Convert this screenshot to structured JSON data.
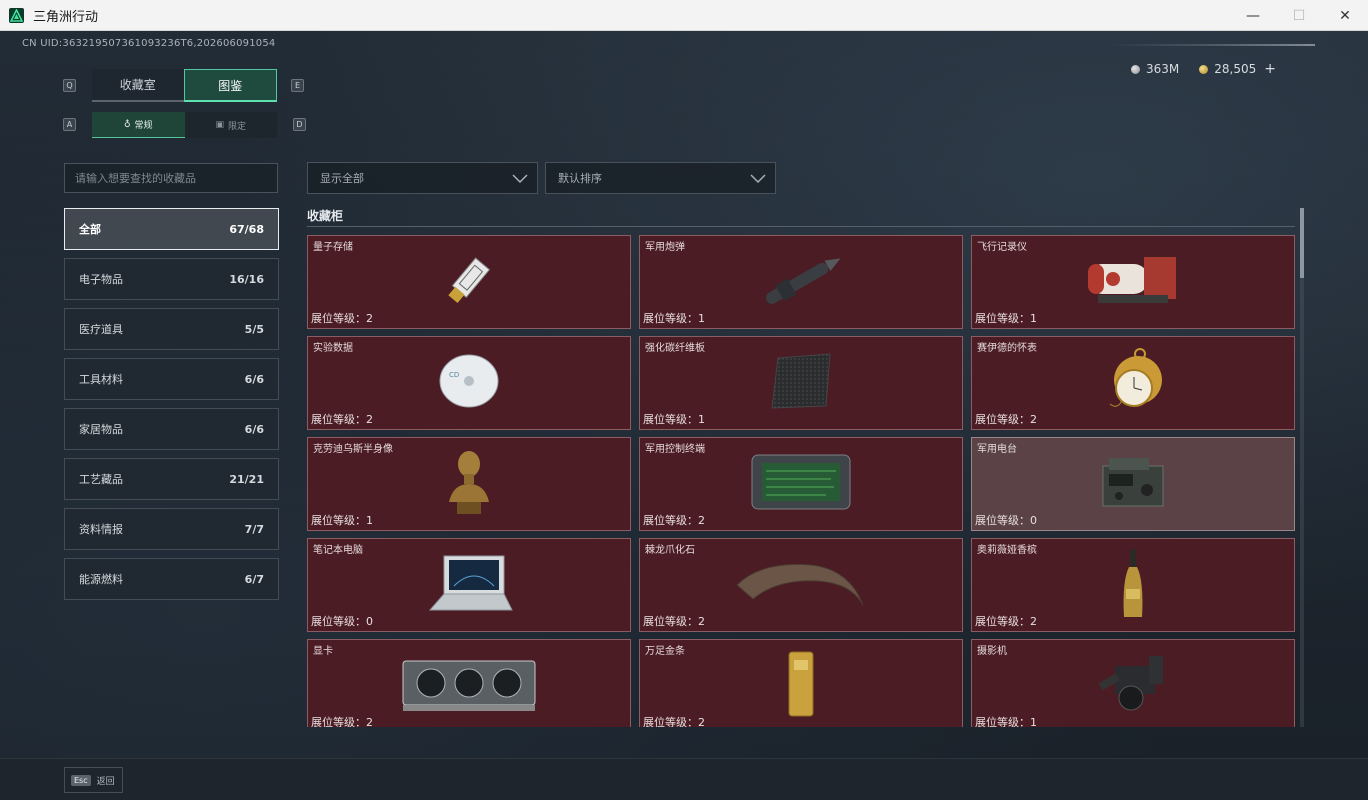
{
  "window": {
    "title": "三角洲行动",
    "controls": {
      "minimize": "—",
      "maximize": "☐",
      "close": "✕"
    }
  },
  "header": {
    "uid_text": "CN UID:363219507361093236T6,202606091054",
    "currency": {
      "silver": "363M",
      "gold": "28,505",
      "add": "+"
    },
    "key_hints": {
      "tab_prev": "Q",
      "tab_next": "E",
      "sub_prev": "A",
      "sub_next": "D"
    }
  },
  "tabs": [
    {
      "label": "收藏室",
      "active": false
    },
    {
      "label": "图鉴",
      "active": true
    }
  ],
  "subtabs": [
    {
      "label": "常规",
      "icon": "flask-icon",
      "glyph": "♁",
      "active": true
    },
    {
      "label": "限定",
      "icon": "box-icon",
      "glyph": "▣",
      "active": false
    }
  ],
  "search": {
    "placeholder": "请输入想要查找的收藏品"
  },
  "categories": [
    {
      "label": "全部",
      "count": "67/68",
      "active": true
    },
    {
      "label": "电子物品",
      "count": "16/16",
      "active": false
    },
    {
      "label": "医疗道具",
      "count": "5/5",
      "active": false
    },
    {
      "label": "工具材料",
      "count": "6/6",
      "active": false
    },
    {
      "label": "家居物品",
      "count": "6/6",
      "active": false
    },
    {
      "label": "工艺藏品",
      "count": "21/21",
      "active": false
    },
    {
      "label": "资料情报",
      "count": "7/7",
      "active": false
    },
    {
      "label": "能源燃料",
      "count": "6/7",
      "active": false
    }
  ],
  "filters": {
    "show": "显示全部",
    "sort": "默认排序"
  },
  "section": {
    "title": "收藏柜"
  },
  "items": [
    {
      "name": "量子存储",
      "level": "展位等级：2",
      "art": "usb-icon"
    },
    {
      "name": "军用炮弹",
      "level": "展位等级：1",
      "art": "shell-icon"
    },
    {
      "name": "飞行记录仪",
      "level": "展位等级：1",
      "art": "recorder-icon"
    },
    {
      "name": "实验数据",
      "level": "展位等级：2",
      "art": "disc-icon"
    },
    {
      "name": "强化碳纤维板",
      "level": "展位等级：1",
      "art": "carbon-plate-icon"
    },
    {
      "name": "赛伊德的怀表",
      "level": "展位等级：2",
      "art": "pocket-watch-icon"
    },
    {
      "name": "克劳迪乌斯半身像",
      "level": "展位等级：1",
      "art": "bust-icon"
    },
    {
      "name": "军用控制终端",
      "level": "展位等级：2",
      "art": "terminal-icon"
    },
    {
      "name": "军用电台",
      "level": "展位等级：0",
      "art": "radio-icon",
      "dim": true
    },
    {
      "name": "笔记本电脑",
      "level": "展位等级：0",
      "art": "laptop-icon"
    },
    {
      "name": "棘龙爪化石",
      "level": "展位等级：2",
      "art": "claw-fossil-icon"
    },
    {
      "name": "奥莉薇娅香槟",
      "level": "展位等级：2",
      "art": "champagne-icon"
    },
    {
      "name": "显卡",
      "level": "展位等级：2",
      "art": "gpu-icon"
    },
    {
      "name": "万足金条",
      "level": "展位等级：2",
      "art": "gold-bar-icon"
    },
    {
      "name": "摄影机",
      "level": "展位等级：1",
      "art": "camera-icon"
    }
  ],
  "footer": {
    "esc_key": "Esc",
    "esc_label": "返回"
  }
}
